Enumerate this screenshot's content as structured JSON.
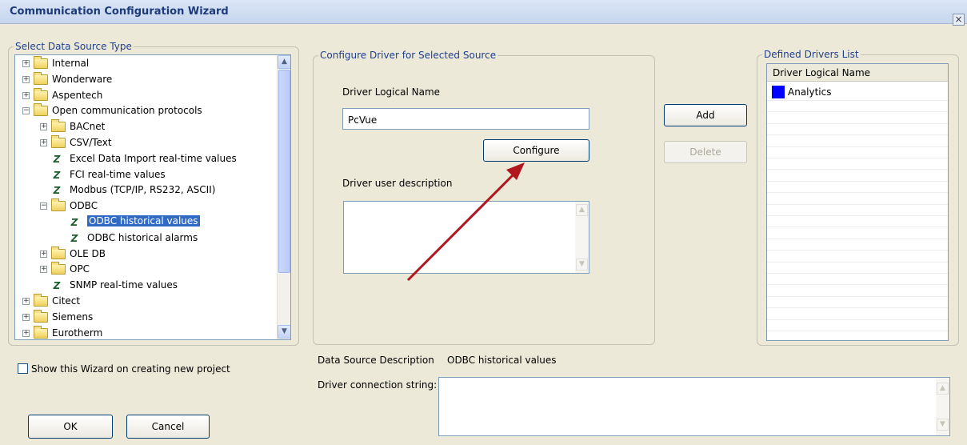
{
  "window": {
    "title": "Communication Configuration Wizard",
    "close_glyph": "×"
  },
  "source_panel": {
    "legend": "Select Data Source Type",
    "tree": [
      {
        "label": "Internal",
        "kind": "folder",
        "level": 0,
        "expander": "+"
      },
      {
        "label": "Wonderware",
        "kind": "folder",
        "level": 0,
        "expander": "+"
      },
      {
        "label": "Aspentech",
        "kind": "folder",
        "level": 0,
        "expander": "+"
      },
      {
        "label": "Open communication protocols",
        "kind": "folder",
        "level": 0,
        "expander": "−"
      },
      {
        "label": "BACnet",
        "kind": "folder",
        "level": 1,
        "expander": "+"
      },
      {
        "label": "CSV/Text",
        "kind": "folder",
        "level": 1,
        "expander": "+"
      },
      {
        "label": "Excel Data Import real-time values",
        "kind": "driver",
        "level": 1
      },
      {
        "label": "FCI real-time values",
        "kind": "driver",
        "level": 1
      },
      {
        "label": "Modbus (TCP/IP, RS232, ASCII)",
        "kind": "driver",
        "level": 1
      },
      {
        "label": "ODBC",
        "kind": "folder",
        "level": 1,
        "expander": "−"
      },
      {
        "label": "ODBC historical values",
        "kind": "driver",
        "level": 2,
        "selected": true
      },
      {
        "label": "ODBC historical alarms",
        "kind": "driver",
        "level": 2
      },
      {
        "label": "OLE DB",
        "kind": "folder",
        "level": 1,
        "expander": "+"
      },
      {
        "label": "OPC",
        "kind": "folder",
        "level": 1,
        "expander": "+"
      },
      {
        "label": "SNMP real-time values",
        "kind": "driver",
        "level": 1
      },
      {
        "label": "Citect",
        "kind": "folder",
        "level": 0,
        "expander": "+"
      },
      {
        "label": "Siemens",
        "kind": "folder",
        "level": 0,
        "expander": "+"
      },
      {
        "label": "Eurotherm",
        "kind": "folder",
        "level": 0,
        "expander": "+"
      }
    ],
    "show_wizard_label": "Show this Wizard on creating new project",
    "show_wizard_checked": false
  },
  "config_panel": {
    "legend": "Configure Driver for Selected Source",
    "logical_name_label": "Driver Logical Name",
    "logical_name_value": "PcVue",
    "configure_label": "Configure",
    "user_description_label": "Driver user description",
    "user_description_value": ""
  },
  "actions": {
    "add_label": "Add",
    "delete_label": "Delete"
  },
  "drivers_panel": {
    "legend": "Defined Drivers List",
    "column_header": "Driver Logical Name",
    "items": [
      {
        "name": "Analytics",
        "color": "#0000ff"
      }
    ]
  },
  "data_source": {
    "description_label": "Data Source Description",
    "description_value": "ODBC historical values",
    "connection_label": "Driver connection string:",
    "connection_value": ""
  },
  "footer": {
    "ok_label": "OK",
    "cancel_label": "Cancel"
  },
  "annotation": {
    "arrow_color": "#b0161c"
  }
}
